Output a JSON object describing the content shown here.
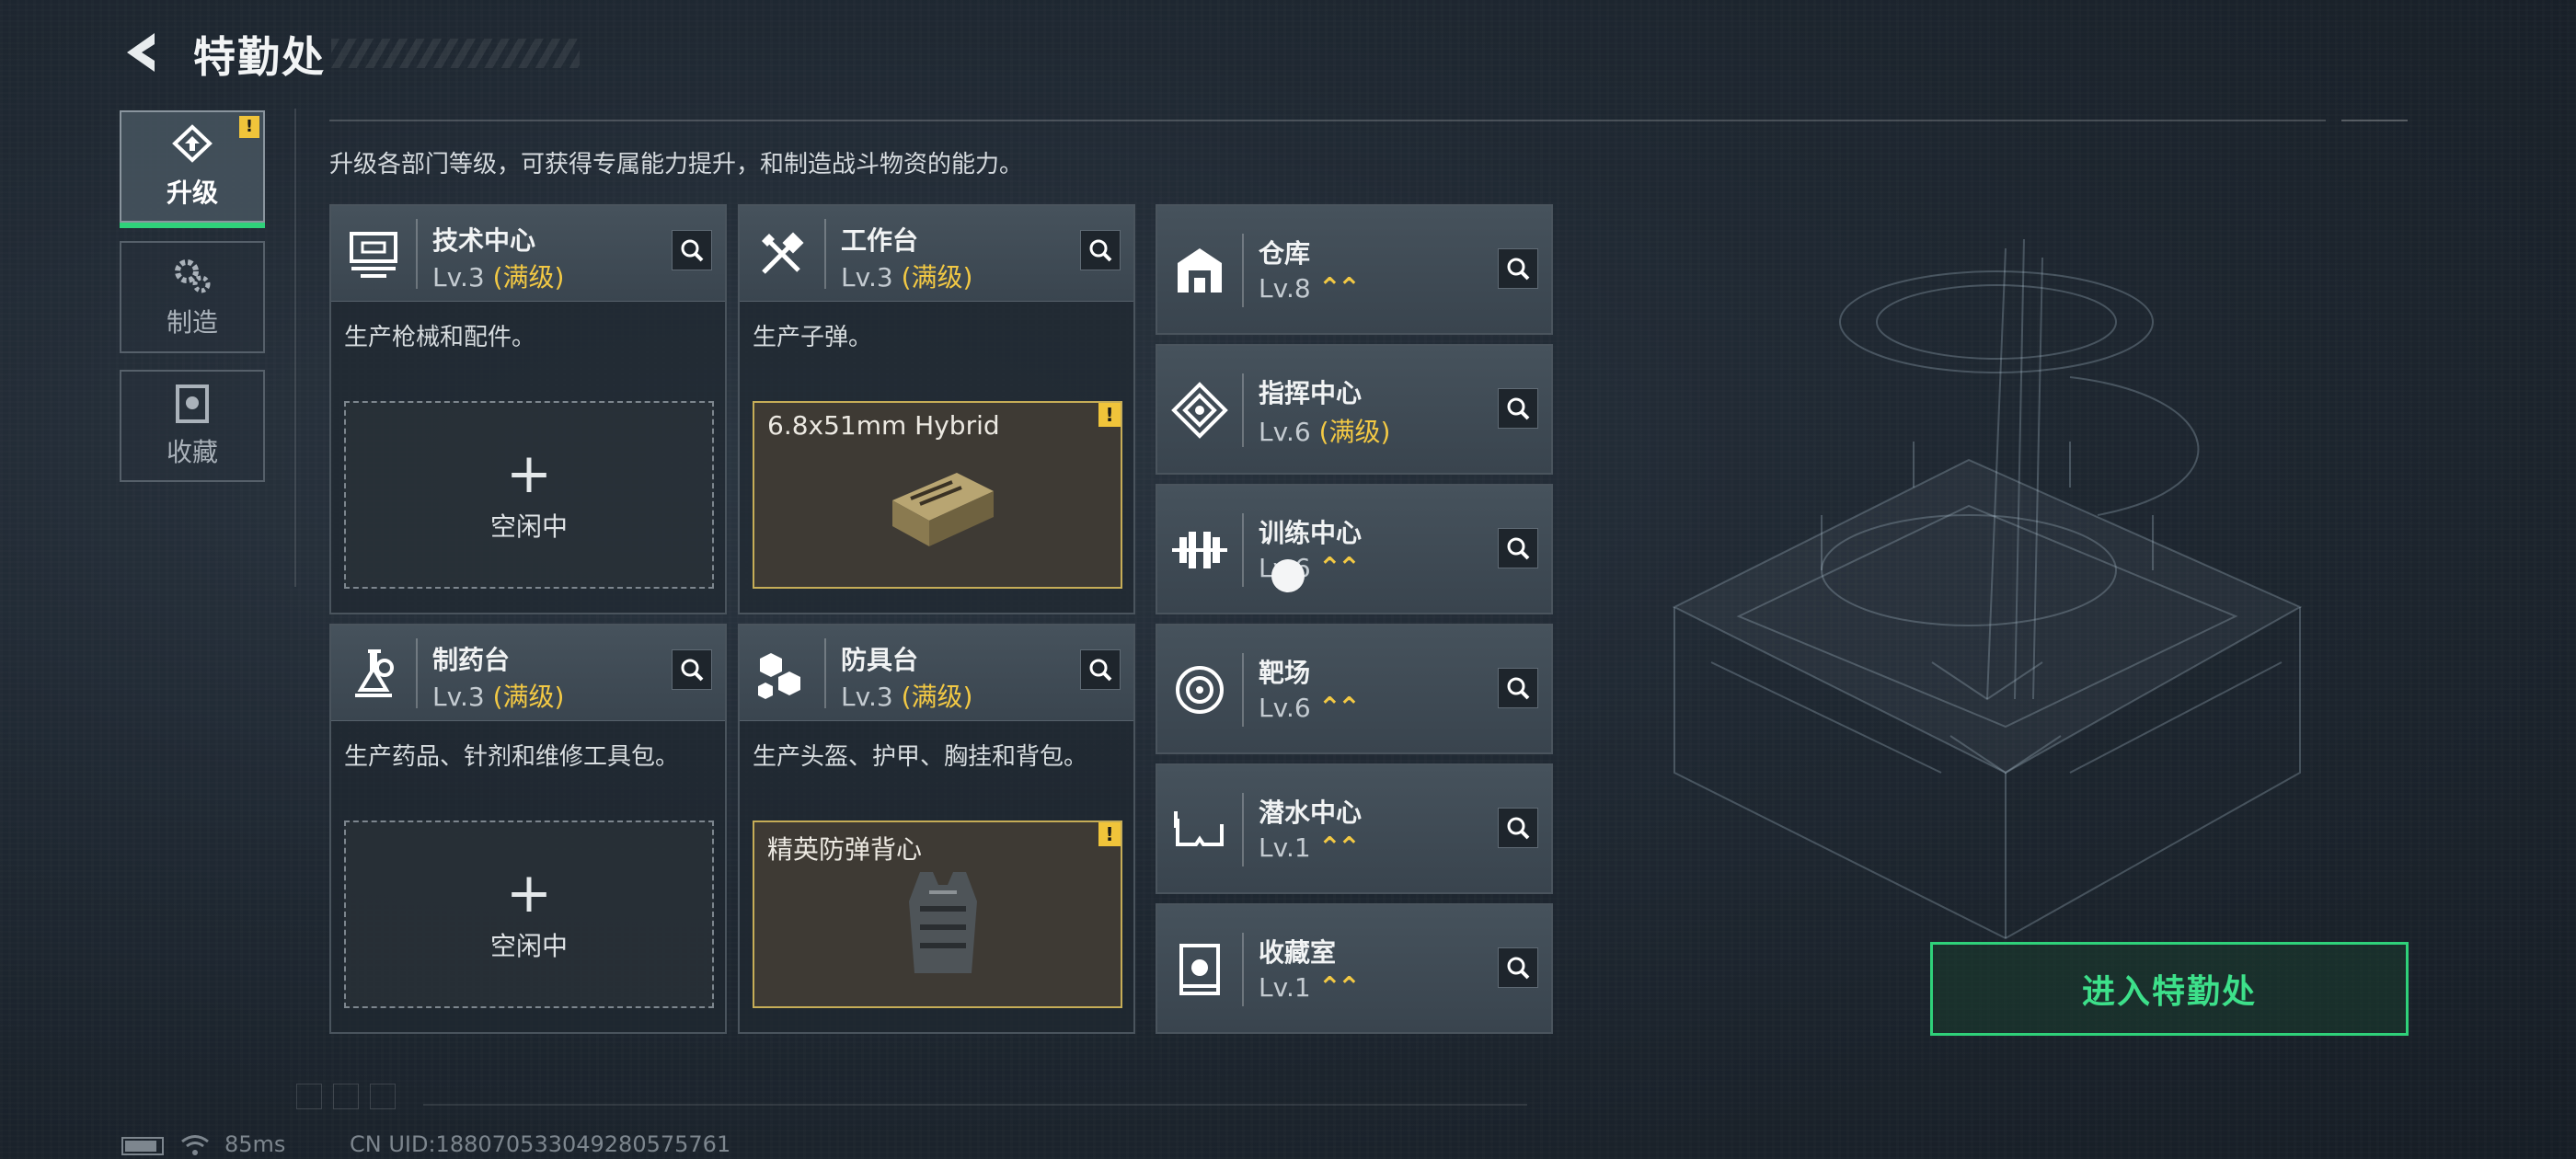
{
  "header": {
    "title": "特勤处",
    "back_icon": "back-chevron-icon"
  },
  "nav": {
    "tabs": [
      {
        "label": "升级",
        "icon": "upgrade-icon",
        "active": true,
        "badge": "!"
      },
      {
        "label": "制造",
        "icon": "gears-icon",
        "active": false
      },
      {
        "label": "收藏",
        "icon": "collection-icon",
        "active": false
      }
    ]
  },
  "description": "升级各部门等级，可获得专属能力提升，和制造战斗物资的能力。",
  "facilities": [
    {
      "name": "技术中心",
      "level": "Lv.3",
      "status": "(满级)",
      "icon": "tech-center-icon",
      "desc": "生产枪械和配件。",
      "slot": {
        "state": "idle",
        "label": "空闲中"
      }
    },
    {
      "name": "工作台",
      "level": "Lv.3",
      "status": "(满级)",
      "icon": "workbench-icon",
      "desc": "生产子弹。",
      "slot": {
        "state": "producing",
        "item": "6.8x51mm Hybrid",
        "badge": "!",
        "item_icon": "ammo-box-icon"
      }
    },
    {
      "name": "制药台",
      "level": "Lv.3",
      "status": "(满级)",
      "icon": "pharmacy-icon",
      "desc": "生产药品、针剂和维修工具包。",
      "slot": {
        "state": "idle",
        "label": "空闲中"
      }
    },
    {
      "name": "防具台",
      "level": "Lv.3",
      "status": "(满级)",
      "icon": "armor-bench-icon",
      "desc": "生产头盔、护甲、胸挂和背包。",
      "slot": {
        "state": "producing",
        "item": "精英防弹背心",
        "badge": "!",
        "item_icon": "vest-icon"
      }
    }
  ],
  "side_facilities": [
    {
      "name": "仓库",
      "level": "Lv.8",
      "status": "",
      "icon": "warehouse-icon",
      "upgradable": true
    },
    {
      "name": "指挥中心",
      "level": "Lv.6",
      "status": "(满级)",
      "icon": "command-center-icon",
      "upgradable": false
    },
    {
      "name": "训练中心",
      "level": "Lv.6",
      "status": "",
      "icon": "training-center-icon",
      "upgradable": true
    },
    {
      "name": "靶场",
      "level": "Lv.6",
      "status": "",
      "icon": "shooting-range-icon",
      "upgradable": true
    },
    {
      "name": "潜水中心",
      "level": "Lv.1",
      "status": "",
      "icon": "diving-center-icon",
      "upgradable": true
    },
    {
      "name": "收藏室",
      "level": "Lv.1",
      "status": "",
      "icon": "collection-room-icon",
      "upgradable": true
    }
  ],
  "enter_button": "进入特勤处",
  "footer": {
    "ping": "85ms",
    "uid": "CN UID:1880705330492805757​61"
  },
  "colors": {
    "accent_green": "#2fd17a",
    "max_yellow": "#f3c944",
    "badge_yellow": "#f0c43a"
  }
}
